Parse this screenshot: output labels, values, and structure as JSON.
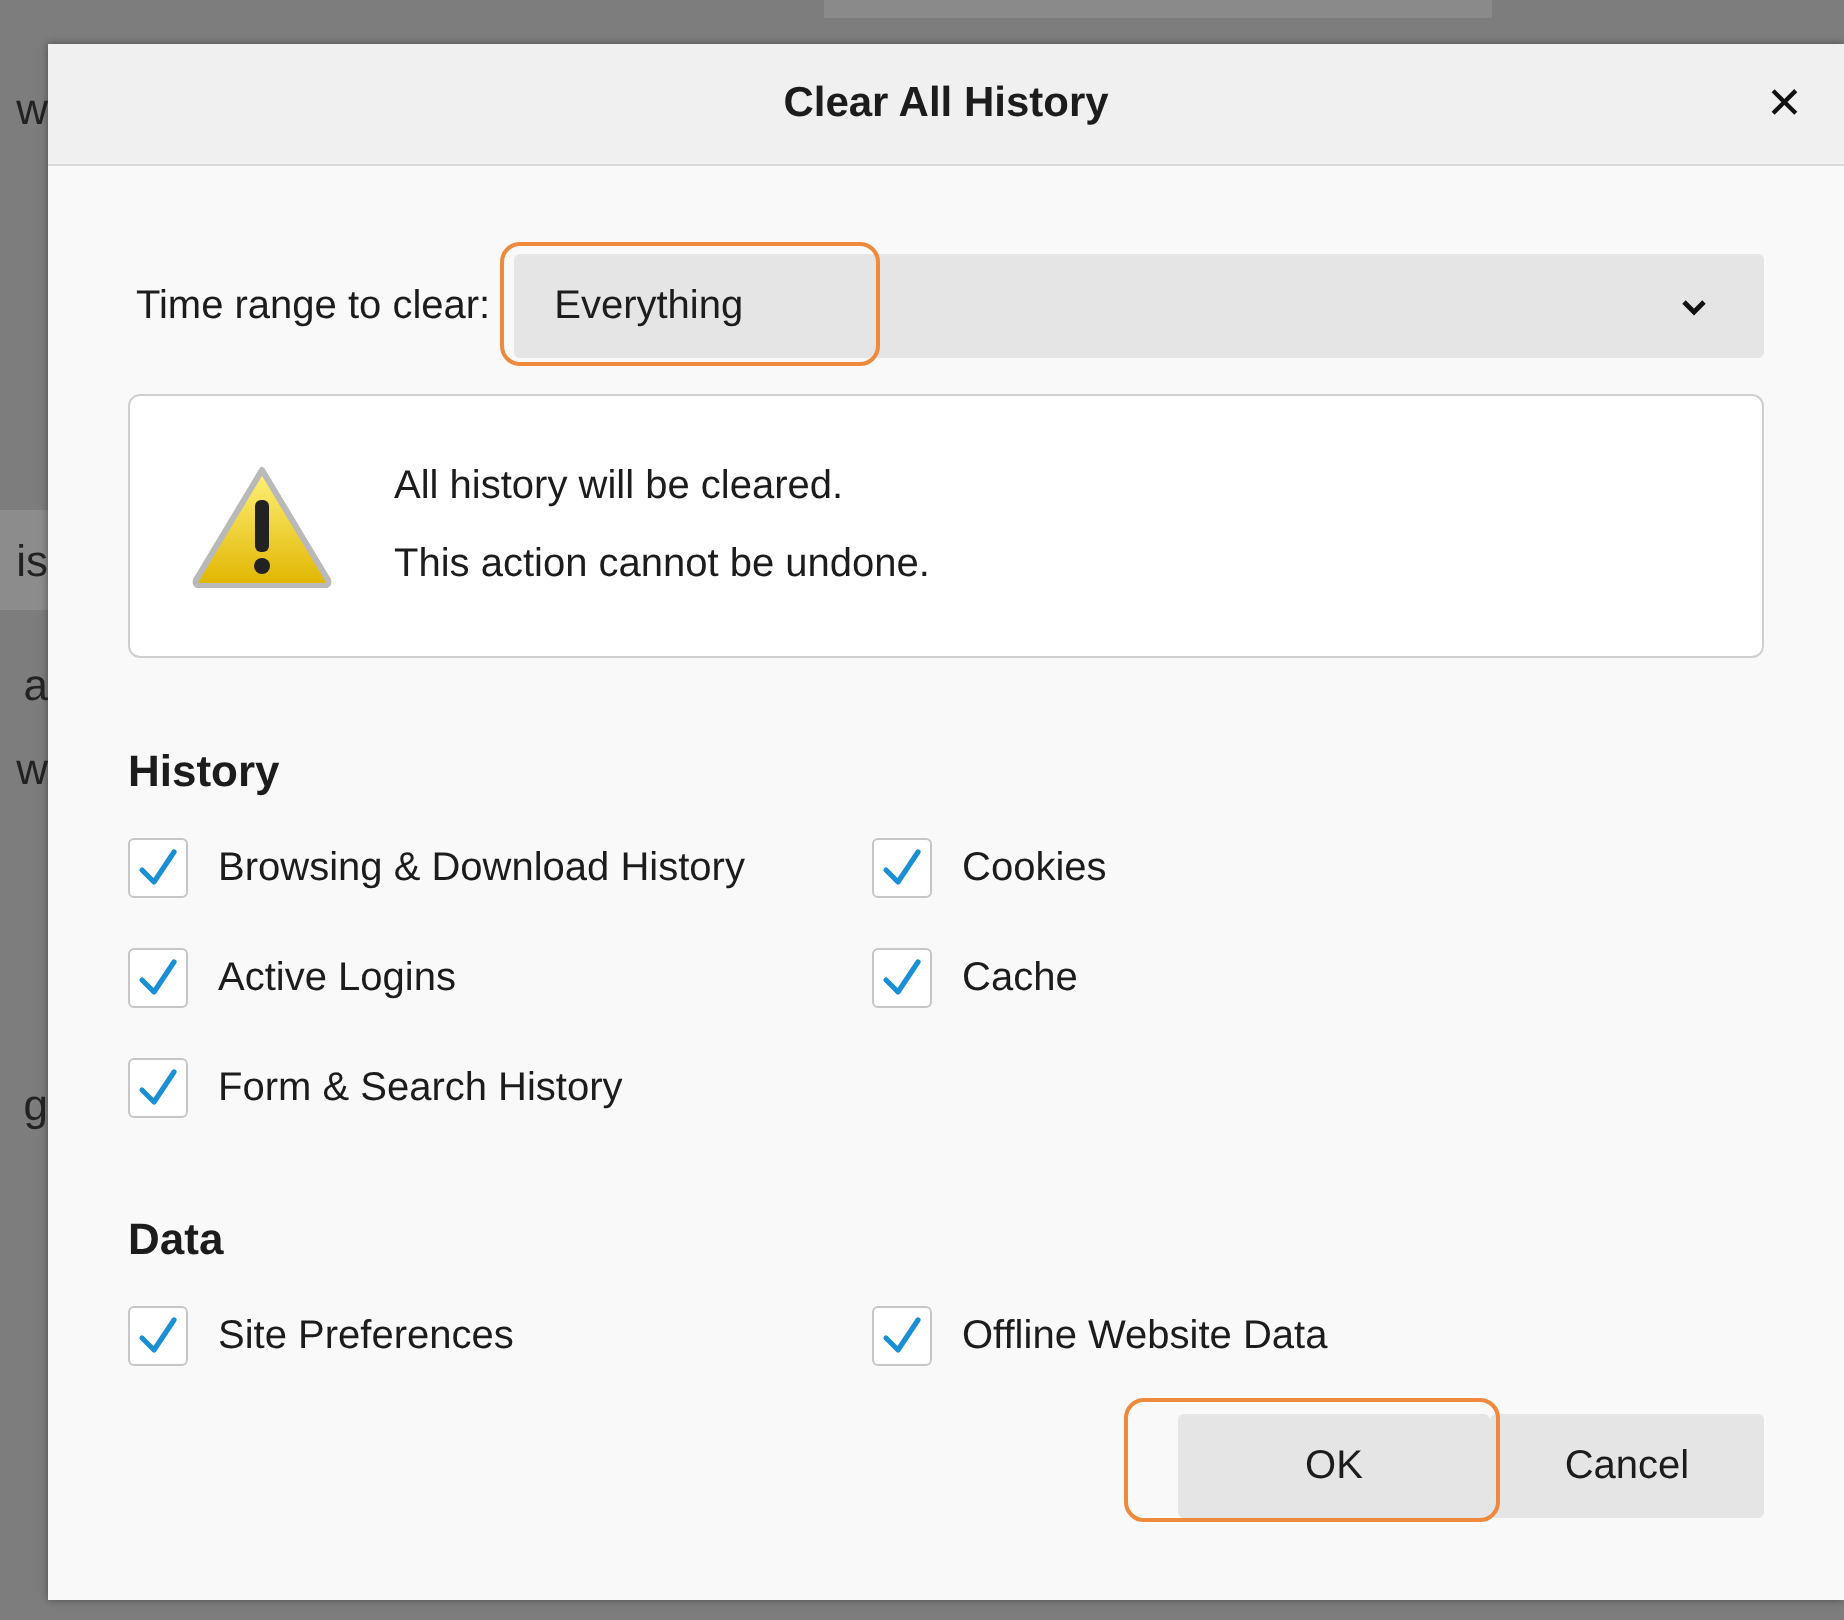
{
  "background": {
    "fragments": [
      "w",
      "is",
      "a",
      "w",
      "g"
    ]
  },
  "window": {
    "title": "Clear All History",
    "close": "✕"
  },
  "time_range": {
    "label": "Time range to clear:",
    "value": "Everything",
    "highlighted": true
  },
  "warning": {
    "lines": [
      "All history will be cleared.",
      "This action cannot be undone."
    ]
  },
  "sections": [
    {
      "heading": "History",
      "items": [
        {
          "label": "Browsing & Download History",
          "checked": true
        },
        {
          "label": "Cookies",
          "checked": true
        },
        {
          "label": "Active Logins",
          "checked": true
        },
        {
          "label": "Cache",
          "checked": true
        },
        {
          "label": "Form & Search History",
          "checked": true
        }
      ]
    },
    {
      "heading": "Data",
      "items": [
        {
          "label": "Site Preferences",
          "checked": true
        },
        {
          "label": "Offline Website Data",
          "checked": true
        }
      ]
    }
  ],
  "buttons": [
    {
      "label": "OK",
      "highlighted": true
    },
    {
      "label": "Cancel",
      "highlighted": false
    }
  ]
}
